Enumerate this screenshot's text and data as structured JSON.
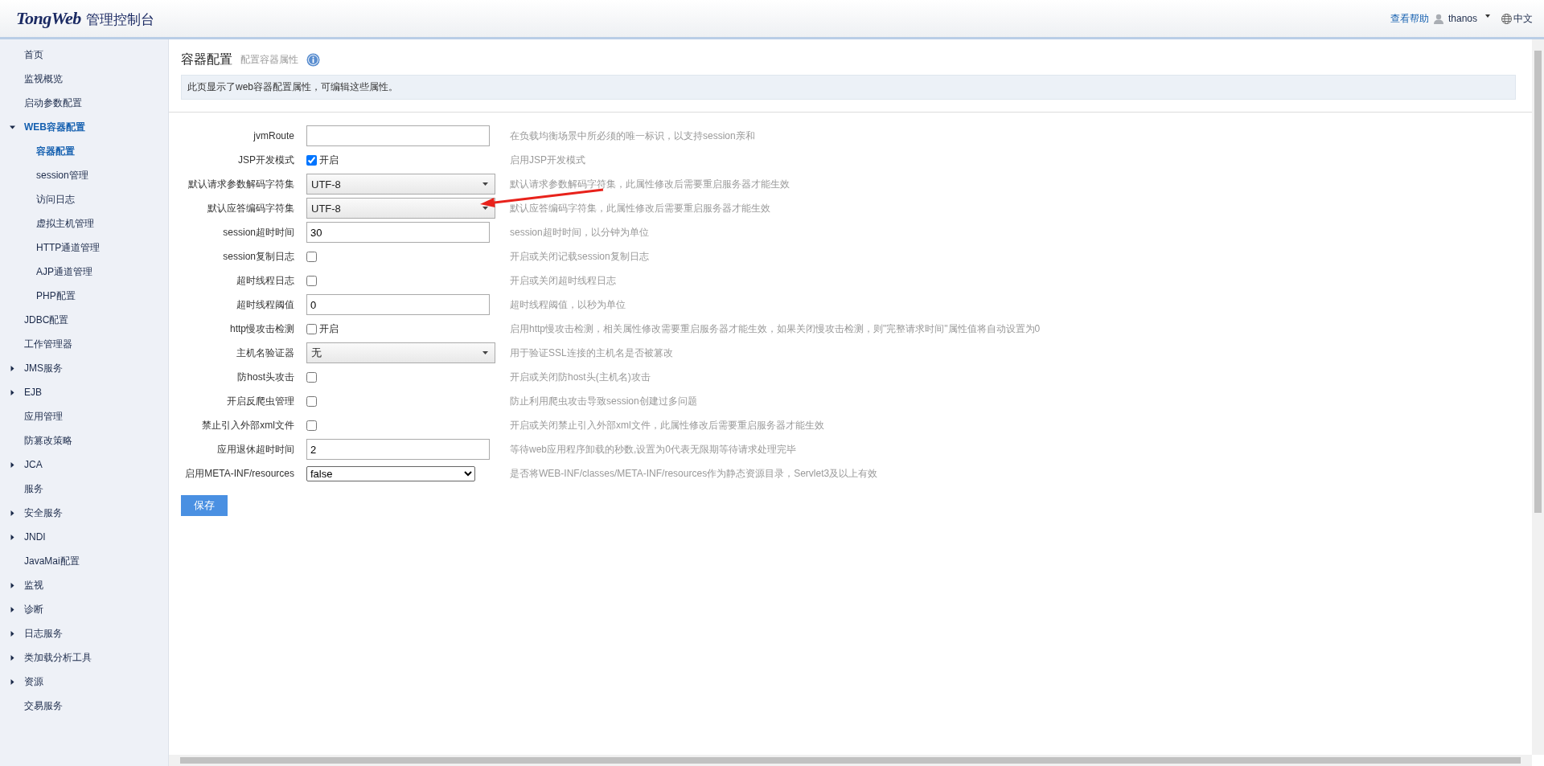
{
  "header": {
    "brand": "TongWeb",
    "subtitle": "管理控制台",
    "help": "查看帮助",
    "user": "thanos",
    "language": "中文"
  },
  "sidebar": {
    "items": [
      {
        "label": "首页",
        "selected": false
      },
      {
        "label": "监视概览",
        "selected": false
      },
      {
        "label": "启动参数配置",
        "selected": false
      },
      {
        "label": "WEB容器配置",
        "selected": true,
        "expanded": true,
        "children": [
          {
            "label": "容器配置",
            "selected": true
          },
          {
            "label": "session管理",
            "selected": false
          },
          {
            "label": "访问日志",
            "selected": false
          },
          {
            "label": "虚拟主机管理",
            "selected": false
          },
          {
            "label": "HTTP通道管理",
            "selected": false
          },
          {
            "label": "AJP通道管理",
            "selected": false
          },
          {
            "label": "PHP配置",
            "selected": false
          }
        ]
      },
      {
        "label": "JDBC配置",
        "selected": false
      },
      {
        "label": "工作管理器",
        "selected": false
      },
      {
        "label": "JMS服务",
        "selected": false,
        "expanded": false
      },
      {
        "label": "EJB",
        "selected": false,
        "expanded": false
      },
      {
        "label": "应用管理",
        "selected": false
      },
      {
        "label": "防篡改策略",
        "selected": false
      },
      {
        "label": "JCA",
        "selected": false,
        "expanded": false
      },
      {
        "label": "服务",
        "selected": false
      },
      {
        "label": "安全服务",
        "selected": false,
        "expanded": false
      },
      {
        "label": "JNDI",
        "selected": false,
        "expanded": false
      },
      {
        "label": "JavaMai配置",
        "selected": false
      },
      {
        "label": "监视",
        "selected": false,
        "expanded": false
      },
      {
        "label": "诊断",
        "selected": false,
        "expanded": false
      },
      {
        "label": "日志服务",
        "selected": false,
        "expanded": false
      },
      {
        "label": "类加载分析工具",
        "selected": false,
        "expanded": false
      },
      {
        "label": "资源",
        "selected": false,
        "expanded": false
      },
      {
        "label": "交易服务",
        "selected": false
      }
    ]
  },
  "page": {
    "title": "容器配置",
    "subtitle": "配置容器属性",
    "info": "此页显示了web容器配置属性，可编辑这些属性。"
  },
  "form": {
    "rows": [
      {
        "kind": "text",
        "label": "jvmRoute",
        "description": "在负载均衡场景中所必须的唯一标识，以支持session亲和"
      },
      {
        "kind": "checkbox",
        "label": "JSP开发模式",
        "checked": true,
        "option": "开启",
        "description": "启用JSP开发模式"
      },
      {
        "kind": "dropdown",
        "label": "默认请求参数解码字符集",
        "value": "UTF-8",
        "description": "默认请求参数解码字符集，此属性修改后需要重启服务器才能生效"
      },
      {
        "kind": "dropdown",
        "label": "默认应答编码字符集",
        "value": "UTF-8",
        "description": "默认应答编码字符集，此属性修改后需要重启服务器才能生效"
      },
      {
        "kind": "text",
        "label": "session超时时间",
        "value": "30",
        "description": "session超时时间，以分钟为单位"
      },
      {
        "kind": "checkbox",
        "label": "session复制日志",
        "checked": false,
        "description": "开启或关闭记载session复制日志"
      },
      {
        "kind": "checkbox",
        "label": "超时线程日志",
        "checked": false,
        "description": "开启或关闭超时线程日志"
      },
      {
        "kind": "text",
        "label": "超时线程阈值",
        "value": "0",
        "description": "超时线程阈值，以秒为单位"
      },
      {
        "kind": "checkbox",
        "label": "http慢攻击检测",
        "checked": false,
        "option": "开启",
        "description": "启用http慢攻击检测，相关属性修改需要重启服务器才能生效，如果关闭慢攻击检测，则\"完整请求时间\"属性值将自动设置为0"
      },
      {
        "kind": "dropdown",
        "label": "主机名验证器",
        "value": "无",
        "description": "用于验证SSL连接的主机名是否被篡改"
      },
      {
        "kind": "checkbox",
        "label": "防host头攻击",
        "checked": false,
        "description": "开启或关闭防host头(主机名)攻击"
      },
      {
        "kind": "checkbox",
        "label": "开启反爬虫管理",
        "checked": false,
        "description": "防止利用爬虫攻击导致session创建过多问题"
      },
      {
        "kind": "checkbox",
        "label": "禁止引入外部xml文件",
        "checked": false,
        "description": "开启或关闭禁止引入外部xml文件，此属性修改后需要重启服务器才能生效"
      },
      {
        "kind": "text",
        "label": "应用退休超时时间",
        "value": "2",
        "description": "等待web应用程序卸载的秒数,设置为0代表无限期等待请求处理完毕"
      },
      {
        "kind": "select",
        "label": "启用META-INF/resources",
        "value": "false",
        "description": "是否将WEB-INF/classes/META-INF/resources作为静态资源目录，Servlet3及以上有效"
      }
    ],
    "save": "保存"
  }
}
